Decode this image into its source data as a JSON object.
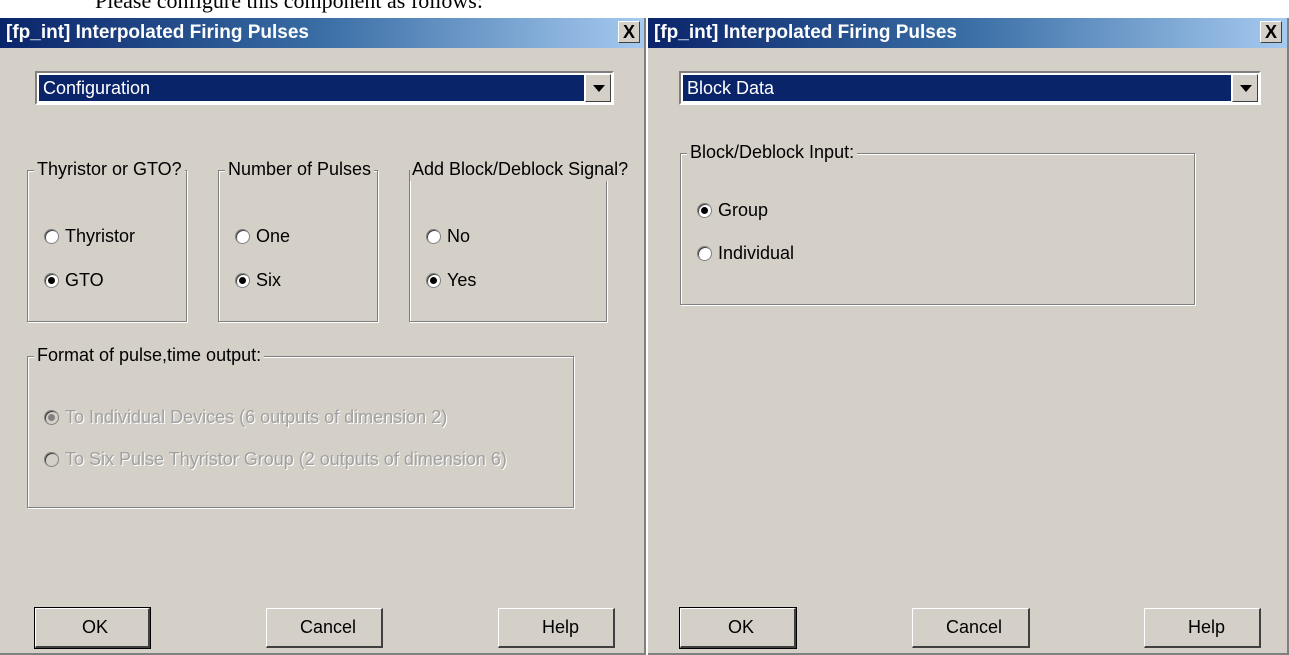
{
  "caption": "Please configure this component as follows:",
  "dialogs": [
    {
      "title": "[fp_int] Interpolated Firing Pulses",
      "close": "X",
      "dropdown": "Configuration",
      "groups": [
        {
          "label": "Thyristor or GTO?",
          "options": [
            "Thyristor",
            "GTO"
          ],
          "selected": "GTO"
        },
        {
          "label": "Number of Pulses",
          "options": [
            "One",
            "Six"
          ],
          "selected": "Six"
        },
        {
          "label": "Add Block/Deblock Signal?",
          "options": [
            "No",
            "Yes"
          ],
          "selected": "Yes"
        },
        {
          "label": "Format of pulse,time output:",
          "options": [
            "To Individual Devices (6 outputs of dimension 2)",
            "To Six Pulse Thyristor Group (2 outputs of dimension 6)"
          ],
          "selected": "To Individual Devices (6 outputs of dimension 2)",
          "disabled": true
        }
      ],
      "buttons": {
        "ok": "OK",
        "cancel": "Cancel",
        "help": "Help"
      }
    },
    {
      "title": "[fp_int] Interpolated Firing Pulses",
      "close": "X",
      "dropdown": "Block Data",
      "groups": [
        {
          "label": "Block/Deblock Input:",
          "options": [
            "Group",
            "Individual"
          ],
          "selected": "Group"
        }
      ],
      "buttons": {
        "ok": "OK",
        "cancel": "Cancel",
        "help": "Help"
      }
    }
  ],
  "colors": {
    "dialog_bg": "#d4d0c8",
    "titlebar": "#0a246a",
    "selection": "#0a246a",
    "disabled_text": "#a0a0a0"
  }
}
